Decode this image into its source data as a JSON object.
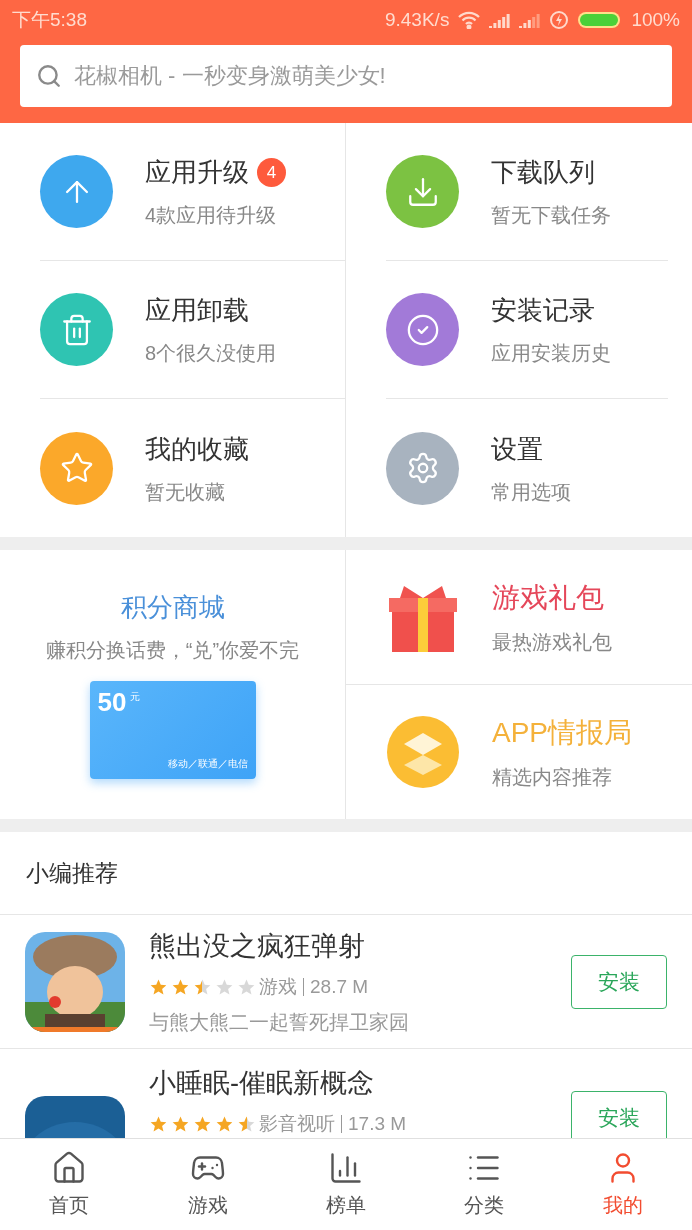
{
  "status_bar": {
    "time": "下午5:38",
    "speed": "9.43K/s",
    "battery": "100%"
  },
  "search": {
    "placeholder": "花椒相机 - 一秒变身激萌美少女!"
  },
  "tools": [
    {
      "kind": "upgrade",
      "title": "应用升级",
      "subtitle": "4款应用待升级",
      "badge": "4",
      "color": "#3ea8ee"
    },
    {
      "kind": "download",
      "title": "下载队列",
      "subtitle": "暂无下载任务",
      "color": "#7cc242"
    },
    {
      "kind": "uninstall",
      "title": "应用卸载",
      "subtitle": "8个很久没使用",
      "color": "#2fc4b2"
    },
    {
      "kind": "history",
      "title": "安装记录",
      "subtitle": "应用安装历史",
      "color": "#a27ad8"
    },
    {
      "kind": "favorite",
      "title": "我的收藏",
      "subtitle": "暂无收藏",
      "color": "#fba82a"
    },
    {
      "kind": "settings",
      "title": "设置",
      "subtitle": "常用选项",
      "color": "#a8b3bf"
    }
  ],
  "points_mall": {
    "title": "积分商城",
    "subtitle": "赚积分换话费，“兑”你爱不完",
    "card_amount": "50",
    "card_unit": "元",
    "card_carriers": "移动／联通／电信"
  },
  "promos": [
    {
      "kind": "gift",
      "title": "游戏礼包",
      "subtitle": "最热游戏礼包",
      "color": "#e5475a"
    },
    {
      "kind": "layers",
      "title": "APP情报局",
      "subtitle": "精选内容推荐",
      "color": "#f4b13a"
    }
  ],
  "recommend": {
    "title": "小编推荐",
    "apps": [
      {
        "name": "熊出没之疯狂弹射",
        "stars": 2.5,
        "category": "游戏",
        "size": "28.7 M",
        "description": "与熊大熊二一起誓死捍卫家园",
        "button": "安装"
      },
      {
        "name": "小睡眠-催眠新概念",
        "stars": 4.5,
        "category": "影音视听",
        "size": "17.3 M",
        "button": "安装"
      }
    ]
  },
  "tabs": [
    {
      "kind": "home",
      "label": "首页",
      "selected": false
    },
    {
      "kind": "games",
      "label": "游戏",
      "selected": false
    },
    {
      "kind": "ranking",
      "label": "榜单",
      "selected": false
    },
    {
      "kind": "category",
      "label": "分类",
      "selected": false
    },
    {
      "kind": "mine",
      "label": "我的",
      "selected": true
    }
  ]
}
